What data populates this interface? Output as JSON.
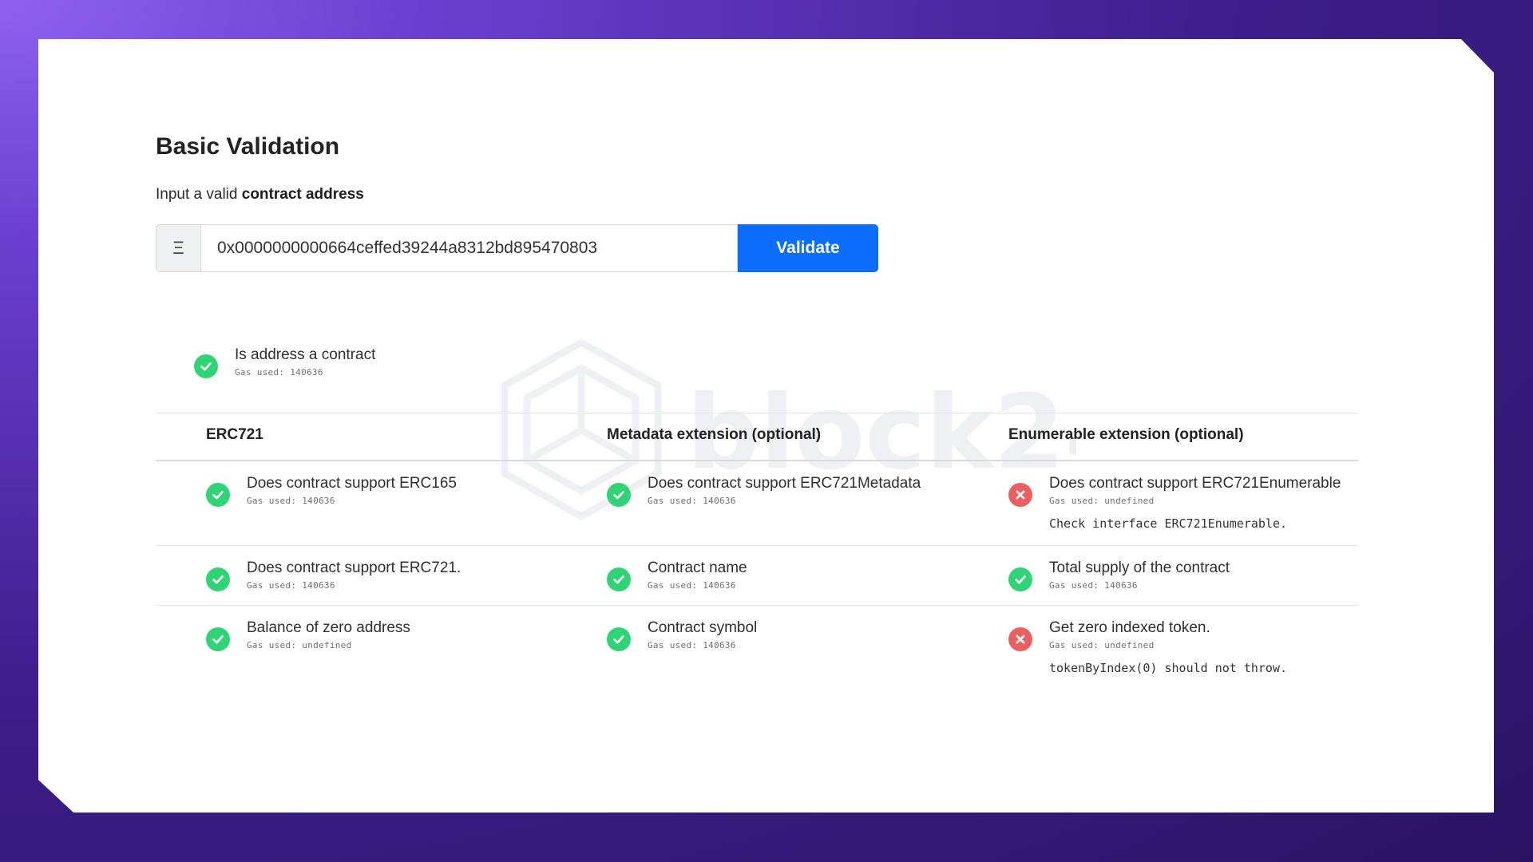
{
  "page": {
    "title": "Basic Validation",
    "subtitle_prefix": "Input a valid",
    "subtitle_bold": "contract address",
    "address_value": "0x0000000000664ceffed39244a8312bd895470803",
    "addon_glyph": "Ξ",
    "validate_label": "Validate"
  },
  "watermark": {
    "text": "block24"
  },
  "address_check": {
    "label": "Is address a contract",
    "gas": "Gas used: 140636",
    "status": "pass"
  },
  "columns": [
    {
      "header": "ERC721",
      "checks": [
        {
          "label": "Does contract support ERC165",
          "gas": "Gas used: 140636",
          "status": "pass"
        },
        {
          "label": "Does contract support ERC721.",
          "gas": "Gas used: 140636",
          "status": "pass"
        },
        {
          "label": "Balance of zero address",
          "gas": "Gas used: undefined",
          "status": "pass"
        }
      ]
    },
    {
      "header": "Metadata extension (optional)",
      "checks": [
        {
          "label": "Does contract support ERC721Metadata",
          "gas": "Gas used: 140636",
          "status": "pass"
        },
        {
          "label": "Contract name",
          "gas": "Gas used: 140636",
          "status": "pass"
        },
        {
          "label": "Contract symbol",
          "gas": "Gas used: 140636",
          "status": "pass"
        }
      ]
    },
    {
      "header": "Enumerable extension (optional)",
      "checks": [
        {
          "label": "Does contract support ERC721Enumerable",
          "gas": "Gas used: undefined",
          "status": "fail",
          "note": "Check interface ERC721Enumerable."
        },
        {
          "label": "Total supply of the contract",
          "gas": "Gas used: 140636",
          "status": "pass"
        },
        {
          "label": "Get zero indexed token.",
          "gas": "Gas used: undefined",
          "status": "fail",
          "note": "tokenByIndex(0) should not throw."
        }
      ]
    }
  ],
  "colors": {
    "background": "#3f1f8d",
    "pass": "#2fd574",
    "fail": "#ec5f5f",
    "button": "#0d6efd"
  }
}
